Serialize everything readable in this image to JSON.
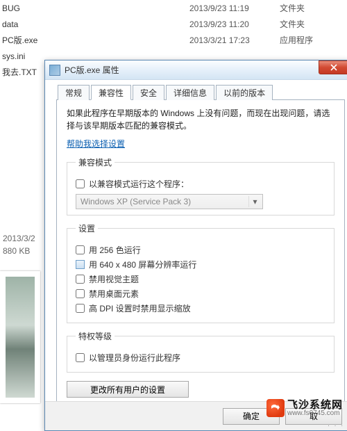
{
  "files": [
    {
      "name": "BUG",
      "date": "2013/9/23 11:19",
      "type": "文件夹"
    },
    {
      "name": "data",
      "date": "2013/9/23 11:20",
      "type": "文件夹"
    },
    {
      "name": "PC版.exe",
      "date": "2013/3/21 17:23",
      "type": "应用程序"
    },
    {
      "name": "sys.ini",
      "date": "",
      "type": ""
    },
    {
      "name": "我去.TXT",
      "date": "",
      "type": ""
    }
  ],
  "info": {
    "date": "2013/3/2",
    "size": "880 KB"
  },
  "dialog": {
    "title": "PC版.exe 属性",
    "tabs": {
      "general": "常规",
      "compat": "兼容性",
      "security": "安全",
      "details": "详细信息",
      "prev": "以前的版本"
    },
    "intro": "如果此程序在早期版本的 Windows 上没有问题，而现在出现问题，请选择与该早期版本匹配的兼容模式。",
    "help_link": "帮助我选择设置",
    "compat_group": "兼容模式",
    "compat_check": "以兼容模式运行这个程序：",
    "compat_value": "Windows XP (Service Pack 3)",
    "settings_group": "设置",
    "settings": {
      "c256": "用 256 色运行",
      "res640": "用 640 x 480 屏幕分辨率运行",
      "novis": "禁用视觉主题",
      "nodesk": "禁用桌面元素",
      "hidpi": "高 DPI 设置时禁用显示缩放"
    },
    "priv_group": "特权等级",
    "priv_check": "以管理员身份运行此程序",
    "all_users_btn": "更改所有用户的设置",
    "ok": "确定",
    "cancel": "取"
  },
  "watermark": {
    "title": "飞沙系统网",
    "url": "www.fs0745.com"
  }
}
